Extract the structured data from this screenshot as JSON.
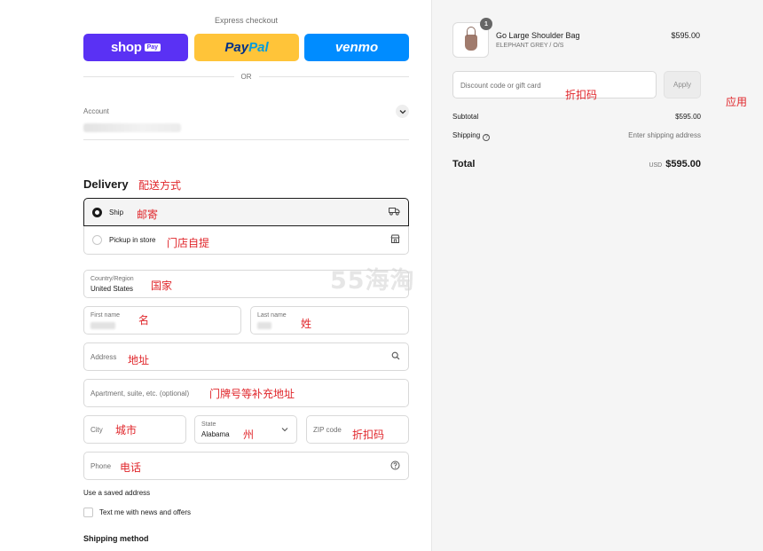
{
  "express": {
    "title": "Express checkout",
    "shop_label": "shop",
    "shop_badge": "Pay",
    "paypal_pay": "Pay",
    "paypal_pal": "Pal",
    "venmo_label": "venmo",
    "or_label": "OR"
  },
  "account": {
    "label": "Account"
  },
  "delivery": {
    "title": "Delivery",
    "ship_label": "Ship",
    "pickup_label": "Pickup in store"
  },
  "form": {
    "country_label": "Country/Region",
    "country_value": "United States",
    "first_name_label": "First name",
    "last_name_label": "Last name",
    "address_placeholder": "Address",
    "apartment_placeholder": "Apartment, suite, etc. (optional)",
    "city_placeholder": "City",
    "state_label": "State",
    "state_value": "Alabama",
    "zip_placeholder": "ZIP code",
    "phone_placeholder": "Phone",
    "saved_address_link": "Use a saved address",
    "news_checkbox_label": "Text me with news and offers",
    "shipping_method_title": "Shipping method"
  },
  "annotations": {
    "delivery": "配送方式",
    "ship": "邮寄",
    "pickup": "门店自提",
    "country": "国家",
    "first_name": "名",
    "last_name": "姓",
    "address": "地址",
    "apartment": "门牌号等补充地址",
    "city": "城市",
    "state": "州",
    "zip": "折扣码",
    "phone": "电话",
    "discount": "折扣码",
    "apply": "应用"
  },
  "watermark": "55海淘",
  "summary": {
    "quantity": "1",
    "product_name": "Go Large Shoulder Bag",
    "product_variant": "ELEPHANT GREY / O/S",
    "product_price": "$595.00",
    "discount_placeholder": "Discount code or gift card",
    "apply_label": "Apply",
    "subtotal_label": "Subtotal",
    "subtotal_value": "$595.00",
    "shipping_label": "Shipping",
    "shipping_value": "Enter shipping address",
    "total_label": "Total",
    "total_currency": "USD",
    "total_value": "$595.00"
  },
  "colors": {
    "shop_pay": "#5a31f4",
    "paypal": "#ffc439",
    "venmo": "#008cff",
    "annotation": "#e0262b"
  },
  "icons": {
    "ship": "truck-icon",
    "pickup": "store-icon",
    "address": "search-icon",
    "phone": "help-circle-icon",
    "account": "chevron-down-icon"
  }
}
